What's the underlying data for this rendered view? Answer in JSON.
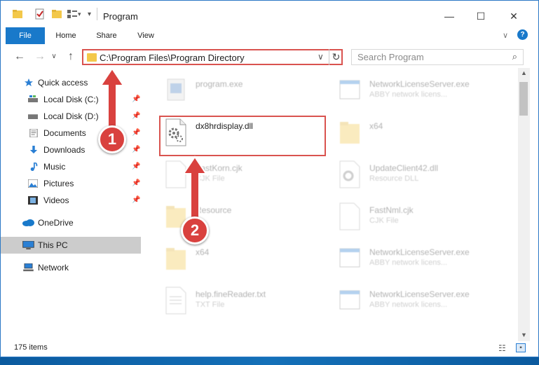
{
  "window": {
    "title": "Program",
    "controls": {
      "minimize": "—",
      "maximize": "☐",
      "close": "✕"
    }
  },
  "ribbon": {
    "tabs": [
      "File",
      "Home",
      "Share",
      "View"
    ],
    "expand": "∨",
    "help": "?"
  },
  "address_bar": {
    "path": "C:\\Program Files\\Program Directory",
    "dropdown": "∨",
    "refresh": "↻"
  },
  "search": {
    "placeholder": "Search Program",
    "icon": "⌕"
  },
  "nav_buttons": {
    "back": "←",
    "forward": "→",
    "recent": "∨",
    "up": "↑"
  },
  "navigation_pane": {
    "items": [
      {
        "label": "Quick access",
        "icon": "star-icon",
        "pinned": false
      },
      {
        "label": "Local Disk (C:)",
        "icon": "drive-icon",
        "pinned": true
      },
      {
        "label": "Local Disk (D:)",
        "icon": "drive-icon",
        "pinned": true
      },
      {
        "label": "Documents",
        "icon": "documents-icon",
        "pinned": true
      },
      {
        "label": "Downloads",
        "icon": "download-icon",
        "pinned": true
      },
      {
        "label": "Music",
        "icon": "music-icon",
        "pinned": true
      },
      {
        "label": "Pictures",
        "icon": "pictures-icon",
        "pinned": true
      },
      {
        "label": "Videos",
        "icon": "videos-icon",
        "pinned": true
      },
      {
        "label": "OneDrive",
        "icon": "cloud-icon",
        "pinned": false
      },
      {
        "label": "This PC",
        "icon": "computer-icon",
        "pinned": false,
        "selected": true
      },
      {
        "label": "Network",
        "icon": "network-icon",
        "pinned": false
      }
    ],
    "pin_glyph": "📌"
  },
  "files": [
    {
      "name": "program.exe",
      "type": "",
      "icon": "exe-icon",
      "faded": true
    },
    {
      "name": "NetworkLicenseServer.exe",
      "type": "ABBY network licens...",
      "icon": "app-window-icon",
      "faded": true
    },
    {
      "name": "dx8hrdisplay.dll",
      "type": "",
      "icon": "dll-gear-icon",
      "faded": false,
      "highlighted": true
    },
    {
      "name": "x64",
      "type": "",
      "icon": "folder-icon",
      "faded": true
    },
    {
      "name": "FastKorn.cjk",
      "type": "CJK File",
      "icon": "blank-file-icon",
      "faded": true
    },
    {
      "name": "UpdateClient42.dll",
      "type": "Resource DLL",
      "icon": "dll-gear-icon",
      "faded": true
    },
    {
      "name": "Resource",
      "type": "",
      "icon": "folder-icon",
      "faded": true
    },
    {
      "name": "FastNml.cjk",
      "type": "CJK File",
      "icon": "blank-file-icon",
      "faded": true
    },
    {
      "name": "x64",
      "type": "",
      "icon": "folder-icon",
      "faded": true
    },
    {
      "name": "NetworkLicenseServer.exe",
      "type": "ABBY network licens...",
      "icon": "app-window-icon",
      "faded": true
    },
    {
      "name": "help.fineReader.txt",
      "type": "TXT File",
      "icon": "text-file-icon",
      "faded": true
    },
    {
      "name": "NetworkLicenseServer.exe",
      "type": "ABBY network licens...",
      "icon": "app-window-icon",
      "faded": true
    }
  ],
  "status_bar": {
    "item_count": "175 items"
  },
  "annotations": {
    "step1": "1",
    "step2": "2",
    "color": "#d9413e"
  }
}
